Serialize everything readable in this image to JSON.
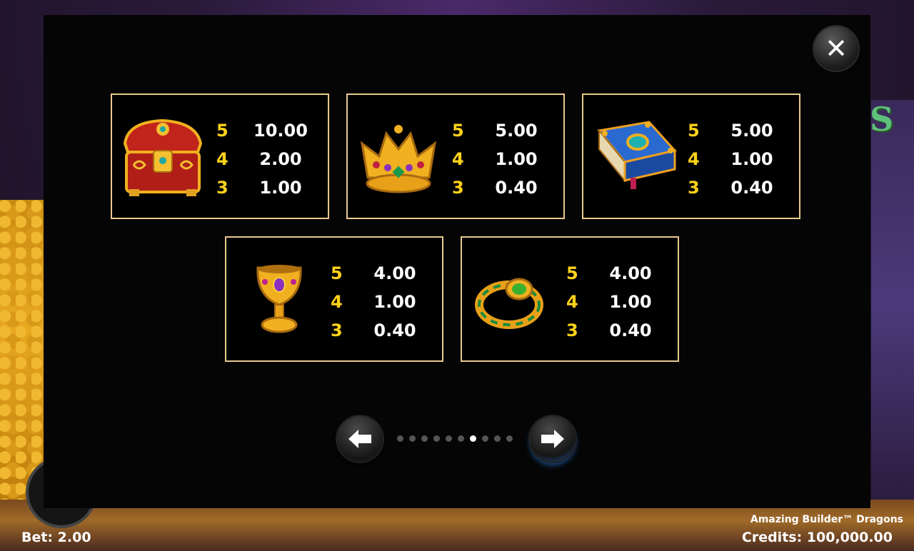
{
  "paytable": {
    "cards": [
      {
        "symbol": "treasure-chest",
        "rows": [
          {
            "count": "5",
            "value": "10.00"
          },
          {
            "count": "4",
            "value": "2.00"
          },
          {
            "count": "3",
            "value": "1.00"
          }
        ]
      },
      {
        "symbol": "crown",
        "rows": [
          {
            "count": "5",
            "value": "5.00"
          },
          {
            "count": "4",
            "value": "1.00"
          },
          {
            "count": "3",
            "value": "0.40"
          }
        ]
      },
      {
        "symbol": "spell-book",
        "rows": [
          {
            "count": "5",
            "value": "5.00"
          },
          {
            "count": "4",
            "value": "1.00"
          },
          {
            "count": "3",
            "value": "0.40"
          }
        ]
      },
      {
        "symbol": "goblet",
        "rows": [
          {
            "count": "5",
            "value": "4.00"
          },
          {
            "count": "4",
            "value": "1.00"
          },
          {
            "count": "3",
            "value": "0.40"
          }
        ]
      },
      {
        "symbol": "ring",
        "rows": [
          {
            "count": "5",
            "value": "4.00"
          },
          {
            "count": "4",
            "value": "1.00"
          },
          {
            "count": "3",
            "value": "0.40"
          }
        ]
      }
    ],
    "pages_total": 10,
    "current_page": 7
  },
  "controls": {
    "close_icon": "close-icon",
    "prev_icon": "arrow-left-icon",
    "next_icon": "arrow-right-icon"
  },
  "footer": {
    "bet": "Bet: 2.00",
    "game_name": "Amazing Builder™ Dragons",
    "credits": "Credits: 100,000.00"
  },
  "colors": {
    "card_border": "#e9c98f",
    "count_color": "#ffd21a",
    "value_color": "#ffffff"
  }
}
